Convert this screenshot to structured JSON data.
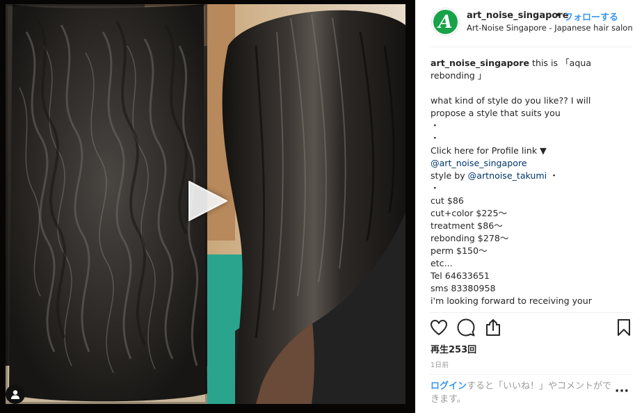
{
  "post": {
    "username": "art_noise_singapore",
    "separator": "•",
    "follow_label": "フォローする",
    "location": "Art-Noise Singapore - Japanese hair salon",
    "avatar_letter": "A",
    "avatar_color": "#18a34a"
  },
  "media": {
    "play_icon": "play-icon",
    "tag_icon": "user-tag-icon"
  },
  "caption": {
    "username": "art_noise_singapore",
    "line1_text": " this is 「aqua",
    "line2": "rebonding 」",
    "line3": "what kind of style do you like?? I will",
    "line4": "propose a style that suits you",
    "line5": "・",
    "line6": "・",
    "line7": "Click here for Profile link ▼",
    "line8_mention": "@art_noise_singapore",
    "line9_prefix": "style by ",
    "line9_mention": "@artnoise_takumi",
    "line9_suffix": " ・",
    "line10": "・",
    "line11": "cut $86",
    "line12": "cut+color $225〜",
    "line13": "treatment $86〜",
    "line14": "rebonding $278〜",
    "line15": "perm $150〜",
    "line16": "etc...",
    "line17": "Tel 64633651",
    "line18": "sms 83380958",
    "line19": "i'm looking forward to receiving your"
  },
  "actions": {
    "like_icon": "heart-icon",
    "comment_icon": "comment-icon",
    "share_icon": "share-icon",
    "save_icon": "bookmark-icon"
  },
  "stats": {
    "views": "再生253回",
    "timestamp": "1日前"
  },
  "footer": {
    "login_link": "ログイン",
    "login_text": "すると「いいね！」やコメントができます。",
    "more_label": "···"
  },
  "colors": {
    "link_blue": "#3897f0",
    "mention_blue": "#003569",
    "text": "#262626",
    "muted": "#999999"
  }
}
